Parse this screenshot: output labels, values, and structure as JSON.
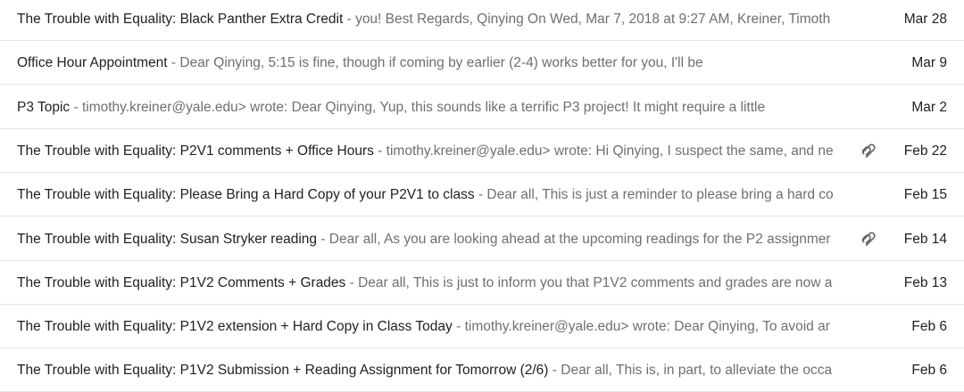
{
  "emails": [
    {
      "subject": "The Trouble with Equality: Black Panther Extra Credit",
      "separator": " - ",
      "snippet": "you! Best Regards, Qinying On Wed, Mar 7, 2018 at 9:27 AM, Kreiner, Timoth",
      "date": "Mar 28",
      "has_attachment": false
    },
    {
      "subject": "Office Hour Appointment",
      "separator": " - ",
      "snippet": "Dear Qinying, 5:15 is fine, though if coming by earlier (2-4) works better for you, I'll be",
      "date": "Mar 9",
      "has_attachment": false
    },
    {
      "subject": "P3 Topic",
      "separator": " - ",
      "snippet": "timothy.kreiner@yale.edu> wrote: Dear Qinying, Yup, this sounds like a terrific P3 project! It might require a little",
      "date": "Mar 2",
      "has_attachment": false
    },
    {
      "subject": "The Trouble with Equality: P2V1 comments + Office Hours",
      "separator": " - ",
      "snippet": "timothy.kreiner@yale.edu> wrote: Hi Qinying,  I suspect the same, and ne",
      "date": "Feb 22",
      "has_attachment": true
    },
    {
      "subject": "The Trouble with Equality: Please Bring a Hard Copy of your P2V1 to class",
      "separator": " - ",
      "snippet": "Dear all, This is just a reminder to please bring a hard co",
      "date": "Feb 15",
      "has_attachment": false
    },
    {
      "subject": "The Trouble with Equality: Susan Stryker reading",
      "separator": " - ",
      "snippet": "Dear all, As you are looking ahead at the upcoming readings for the P2 assignmer",
      "date": "Feb 14",
      "has_attachment": true
    },
    {
      "subject": "The Trouble with Equality: P1V2 Comments + Grades",
      "separator": " - ",
      "snippet": "Dear all, This is just to inform you that P1V2 comments and grades are now a",
      "date": "Feb 13",
      "has_attachment": false
    },
    {
      "subject": "The Trouble with Equality: P1V2 extension + Hard Copy in Class Today",
      "separator": " - ",
      "snippet": "timothy.kreiner@yale.edu> wrote: Dear Qinying, To avoid ar",
      "date": "Feb 6",
      "has_attachment": false
    },
    {
      "subject": "The Trouble with Equality: P1V2 Submission + Reading Assignment for Tomorrow (2/6)",
      "separator": " - ",
      "snippet": "Dear all, This is, in part, to alleviate the occa",
      "date": "Feb 6",
      "has_attachment": false
    }
  ],
  "attachment_icon": "paperclip-icon",
  "colors": {
    "subject": "#202124",
    "snippet": "#6f6f6f",
    "divider": "#e6e6e6"
  }
}
